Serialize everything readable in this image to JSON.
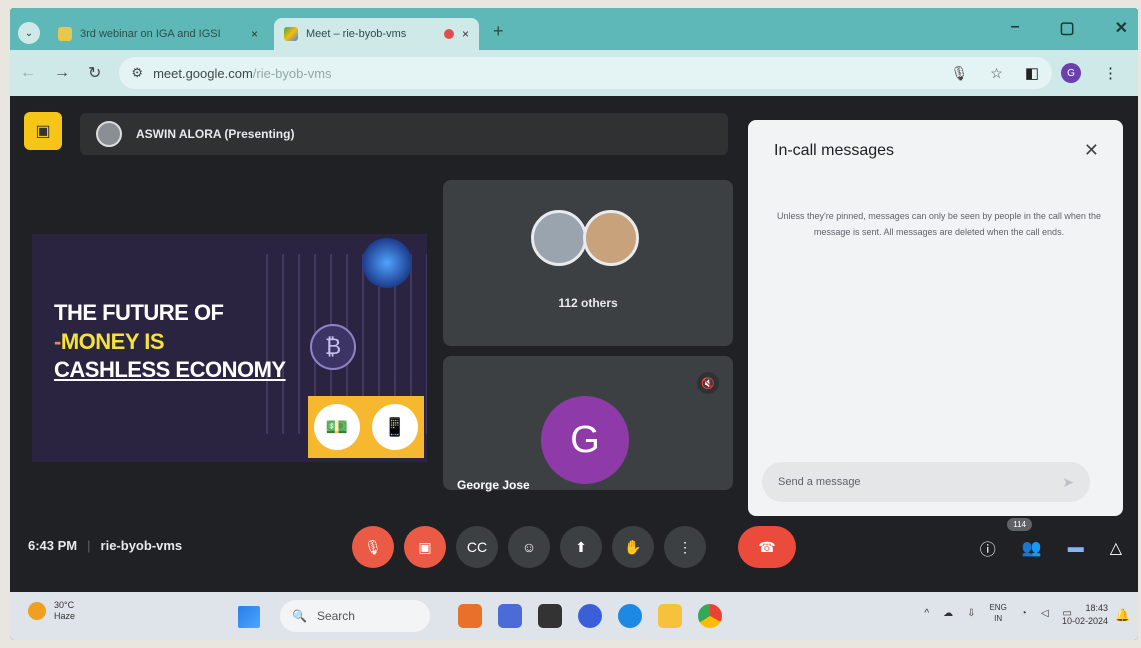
{
  "browser": {
    "tabs": [
      {
        "title": "3rd webinar on IGA and IGSI",
        "close": "×",
        "active": false
      },
      {
        "title": "Meet – rie-byob-vms",
        "close": "×",
        "active": true
      }
    ],
    "tab_dropdown": "⌄",
    "new_tab": "+",
    "window_controls": {
      "minimize": "–",
      "maximize": "▢",
      "close": "✕"
    },
    "nav": {
      "back": "←",
      "forward": "→",
      "reload": "↻"
    },
    "url_host": "meet.google.com",
    "url_path": "/rie-byob-vms",
    "profile_initial": "G"
  },
  "meet": {
    "presenter_label": "ASWIN ALORA (Presenting)",
    "slide": {
      "line1": "THE FUTURE OF",
      "line2_dash": "-",
      "line2": "MONEY IS",
      "line3": "CASHLESS ECONOMY"
    },
    "others_label": "112 others",
    "participant": {
      "initial": "G",
      "name": "George Jose"
    },
    "chat": {
      "title": "In-call messages",
      "info": "Unless they're pinned, messages can only be seen by people in the call when the message is sent. All messages are deleted when the call ends.",
      "placeholder": "Send a message"
    },
    "time": "6:43 PM",
    "meeting_code": "rie-byob-vms",
    "participant_count": "114"
  },
  "taskbar": {
    "temperature": "30°C",
    "weather": "Haze",
    "search": "Search",
    "lang_top": "ENG",
    "lang_bottom": "IN",
    "clock_time": "18:43",
    "clock_date": "10-02-2024"
  },
  "colors": {
    "accent_red": "#ea5a45",
    "meet_bg": "#202124",
    "tab_teal": "#5fb8b8"
  }
}
